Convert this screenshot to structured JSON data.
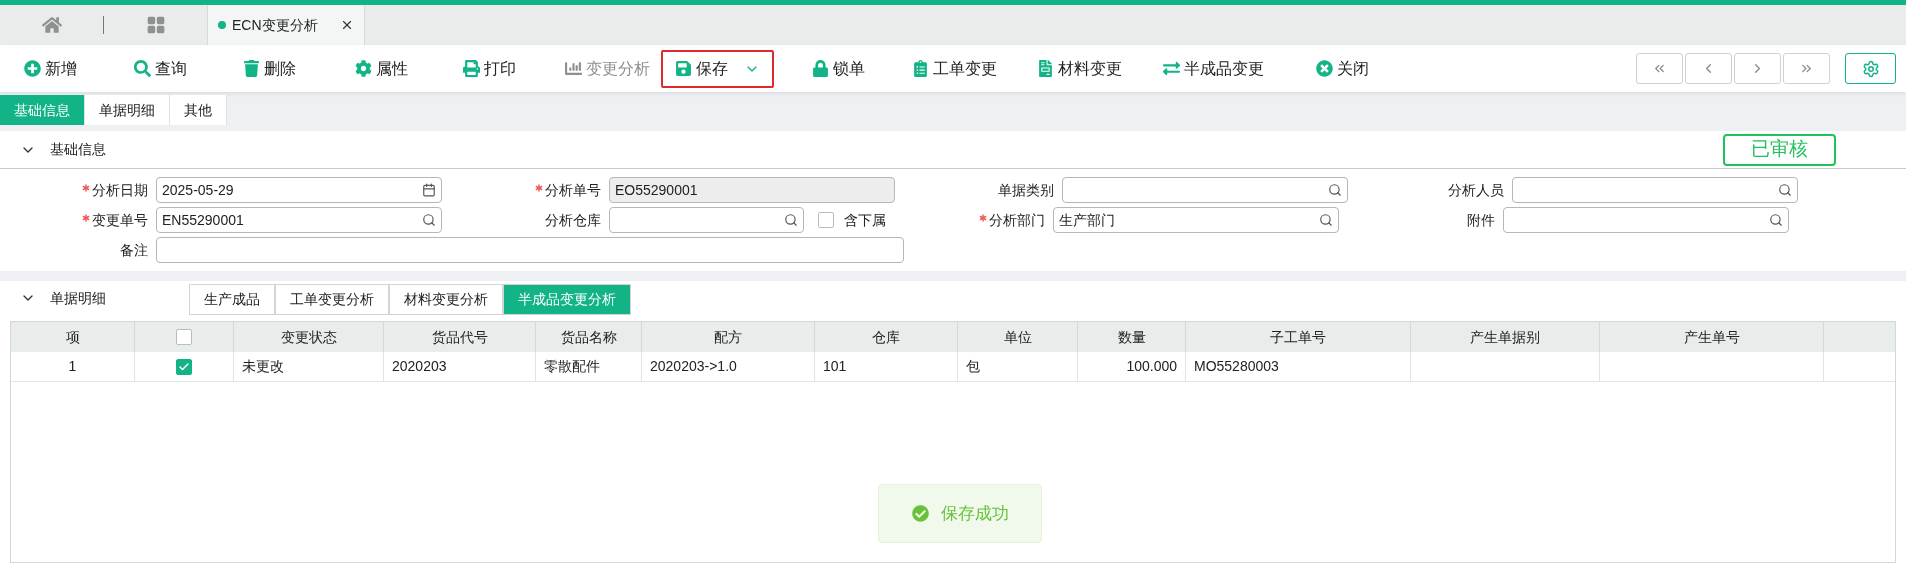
{
  "app_tabs": [
    {
      "label": "ECN变更分析",
      "selected": true
    }
  ],
  "toolbar": [
    {
      "label": "新增",
      "kind": "button",
      "disabled": false,
      "highlighted": false
    },
    {
      "label": "查询",
      "kind": "button",
      "disabled": false,
      "highlighted": false
    },
    {
      "label": "删除",
      "kind": "button",
      "disabled": false,
      "highlighted": false
    },
    {
      "label": "属性",
      "kind": "button",
      "disabled": false,
      "highlighted": false
    },
    {
      "label": "打印",
      "kind": "button",
      "disabled": false,
      "highlighted": false
    },
    {
      "label": "变更分析",
      "kind": "button",
      "disabled": true,
      "highlighted": false
    },
    {
      "label": "保存",
      "kind": "dropdown",
      "disabled": false,
      "highlighted": true
    },
    {
      "label": "锁单",
      "kind": "button",
      "disabled": false,
      "highlighted": false
    },
    {
      "label": "工单变更",
      "kind": "button",
      "disabled": false,
      "highlighted": false
    },
    {
      "label": "材料变更",
      "kind": "button",
      "disabled": false,
      "highlighted": false
    },
    {
      "label": "半成品变更",
      "kind": "button",
      "disabled": false,
      "highlighted": false
    },
    {
      "label": "关闭",
      "kind": "button",
      "disabled": false,
      "highlighted": false
    }
  ],
  "sub_tabs": [
    {
      "label": "基础信息",
      "selected": true
    },
    {
      "label": "单据明细",
      "selected": false
    },
    {
      "label": "其他",
      "selected": false
    }
  ],
  "basic_section": {
    "title": "基础信息",
    "expanded": true,
    "status_stamp": "已审核",
    "rows": [
      [
        {
          "label": "分析日期",
          "value": "2025-05-29",
          "kind": "date",
          "required": true
        },
        {
          "label": "分析单号",
          "value": "EO55290001",
          "kind": "readonly",
          "required": true
        },
        {
          "label": "单据类别",
          "kind": "lookup",
          "required": false
        },
        {
          "label": "分析人员",
          "kind": "lookup",
          "required": false
        }
      ],
      [
        {
          "label": "变更单号",
          "value": "EN55290001",
          "kind": "lookup",
          "required": true
        },
        {
          "label": "分析仓库",
          "kind": "lookup",
          "required": false,
          "checkbox": {
            "label": "含下属",
            "checked": false
          }
        },
        {
          "label": "分析部门",
          "value": "生产部门",
          "kind": "lookup",
          "required": true
        },
        {
          "label": "附件",
          "kind": "lookup",
          "required": false
        }
      ],
      [
        {
          "label": "备注",
          "kind": "memo",
          "required": false
        }
      ]
    ]
  },
  "detail_section": {
    "title": "单据明细",
    "expanded": true,
    "tabs": [
      {
        "label": "生产成品",
        "selected": false
      },
      {
        "label": "工单变更分析",
        "selected": false
      },
      {
        "label": "材料变更分析",
        "selected": false
      },
      {
        "label": "半成品变更分析",
        "selected": true
      }
    ],
    "table": {
      "columns": [
        {
          "kind": "text",
          "label": "项"
        },
        {
          "kind": "checkbox",
          "checked": false
        },
        {
          "kind": "text",
          "label": "变更状态"
        },
        {
          "kind": "text",
          "label": "货品代号"
        },
        {
          "kind": "text",
          "label": "货品名称"
        },
        {
          "kind": "text",
          "label": "配方"
        },
        {
          "kind": "text",
          "label": "仓库"
        },
        {
          "kind": "text",
          "label": "单位"
        },
        {
          "kind": "text",
          "label": "数量"
        },
        {
          "kind": "text",
          "label": "子工单号"
        },
        {
          "kind": "text",
          "label": "产生单据别"
        },
        {
          "kind": "text",
          "label": "产生单号"
        }
      ],
      "rows": [
        {
          "cells": [
            {
              "kind": "text",
              "text": "1"
            },
            {
              "kind": "checkbox",
              "checked": true
            },
            {
              "kind": "text",
              "text": "未更改"
            },
            {
              "kind": "text",
              "text": "2020203"
            },
            {
              "kind": "text",
              "text": "零散配件"
            },
            {
              "kind": "text",
              "text": "2020203->1.0"
            },
            {
              "kind": "text",
              "text": "101"
            },
            {
              "kind": "text",
              "text": "包"
            },
            {
              "kind": "text",
              "text": "100.000"
            },
            {
              "kind": "text",
              "text": "MO55280003"
            }
          ]
        }
      ]
    }
  },
  "toast": {
    "kind": "success",
    "text": "保存成功"
  }
}
